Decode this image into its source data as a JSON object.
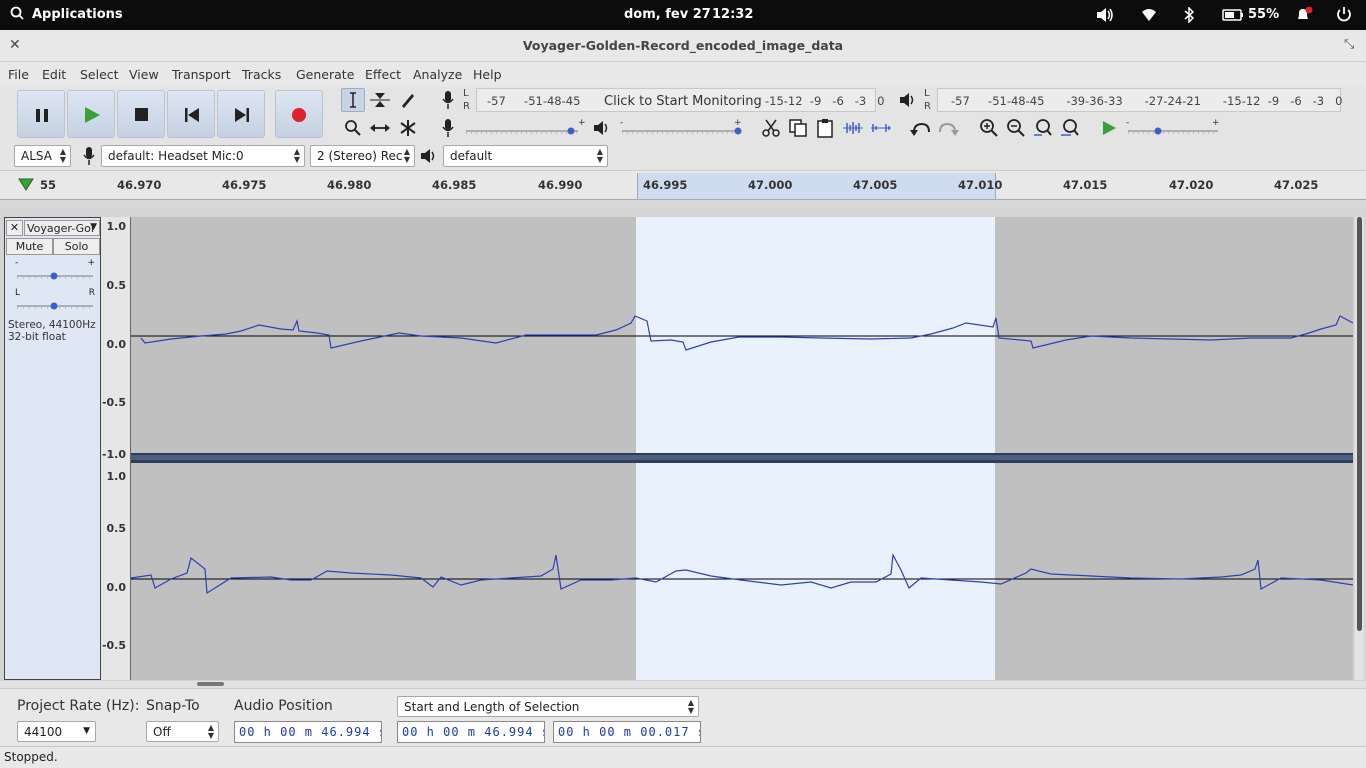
{
  "topbar": {
    "applications": "Applications",
    "date": "dom, fev 27",
    "time": "12:32",
    "battery": "55%"
  },
  "window": {
    "title": "Voyager-Golden-Record_encoded_image_data"
  },
  "menu": [
    "File",
    "Edit",
    "Select",
    "View",
    "Transport",
    "Tracks",
    "Generate",
    "Effect",
    "Analyze",
    "Help"
  ],
  "meters": {
    "record_scale": "-57     -51-48-45",
    "record_prompt": "Click to Start Monitoring",
    "record_scale_right": "-15-12  -9   -6   -3   0",
    "play_scale": "-57     -51-48-45      -39-36-33      -27-24-21      -15-12  -9   -6   -3   0",
    "lr": "L\nR"
  },
  "device": {
    "host": "ALSA",
    "input": "default: Headset Mic:0",
    "channels": "2 (Stereo) Rec",
    "output": "default"
  },
  "ruler": {
    "ticks": [
      "55",
      "46.970",
      "46.975",
      "46.980",
      "46.985",
      "46.990",
      "46.995",
      "47.000",
      "47.005",
      "47.010",
      "47.015",
      "47.020",
      "47.025"
    ]
  },
  "track": {
    "name": "Voyager-Gol",
    "mute": "Mute",
    "solo": "Solo",
    "gain_minus": "-",
    "gain_plus": "+",
    "pan_left": "L",
    "pan_right": "R",
    "info1": "Stereo, 44100Hz",
    "info2": "32-bit float",
    "axis_top": [
      "1.0",
      "0.5",
      "0.0",
      "-0.5",
      "-1.0"
    ],
    "axis_bottom": [
      "1.0",
      "0.5",
      "0.0",
      "-0.5"
    ]
  },
  "selection_bar": {
    "project_rate_label": "Project Rate (Hz):",
    "project_rate_value": "44100",
    "snap_label": "Snap-To",
    "snap_value": "Off",
    "audio_position_label": "Audio Position",
    "audio_position_value": "00 h 00 m 46.994 s",
    "selection_mode": "Start and Length of Selection",
    "selection_start": "00 h 00 m 46.994 s",
    "selection_length": "00 h 00 m 00.017 s"
  },
  "status": "Stopped.",
  "colors": {
    "waveform": "#2f3fb5",
    "selection": "#e9f1fd",
    "background": "#c0c0c0"
  }
}
